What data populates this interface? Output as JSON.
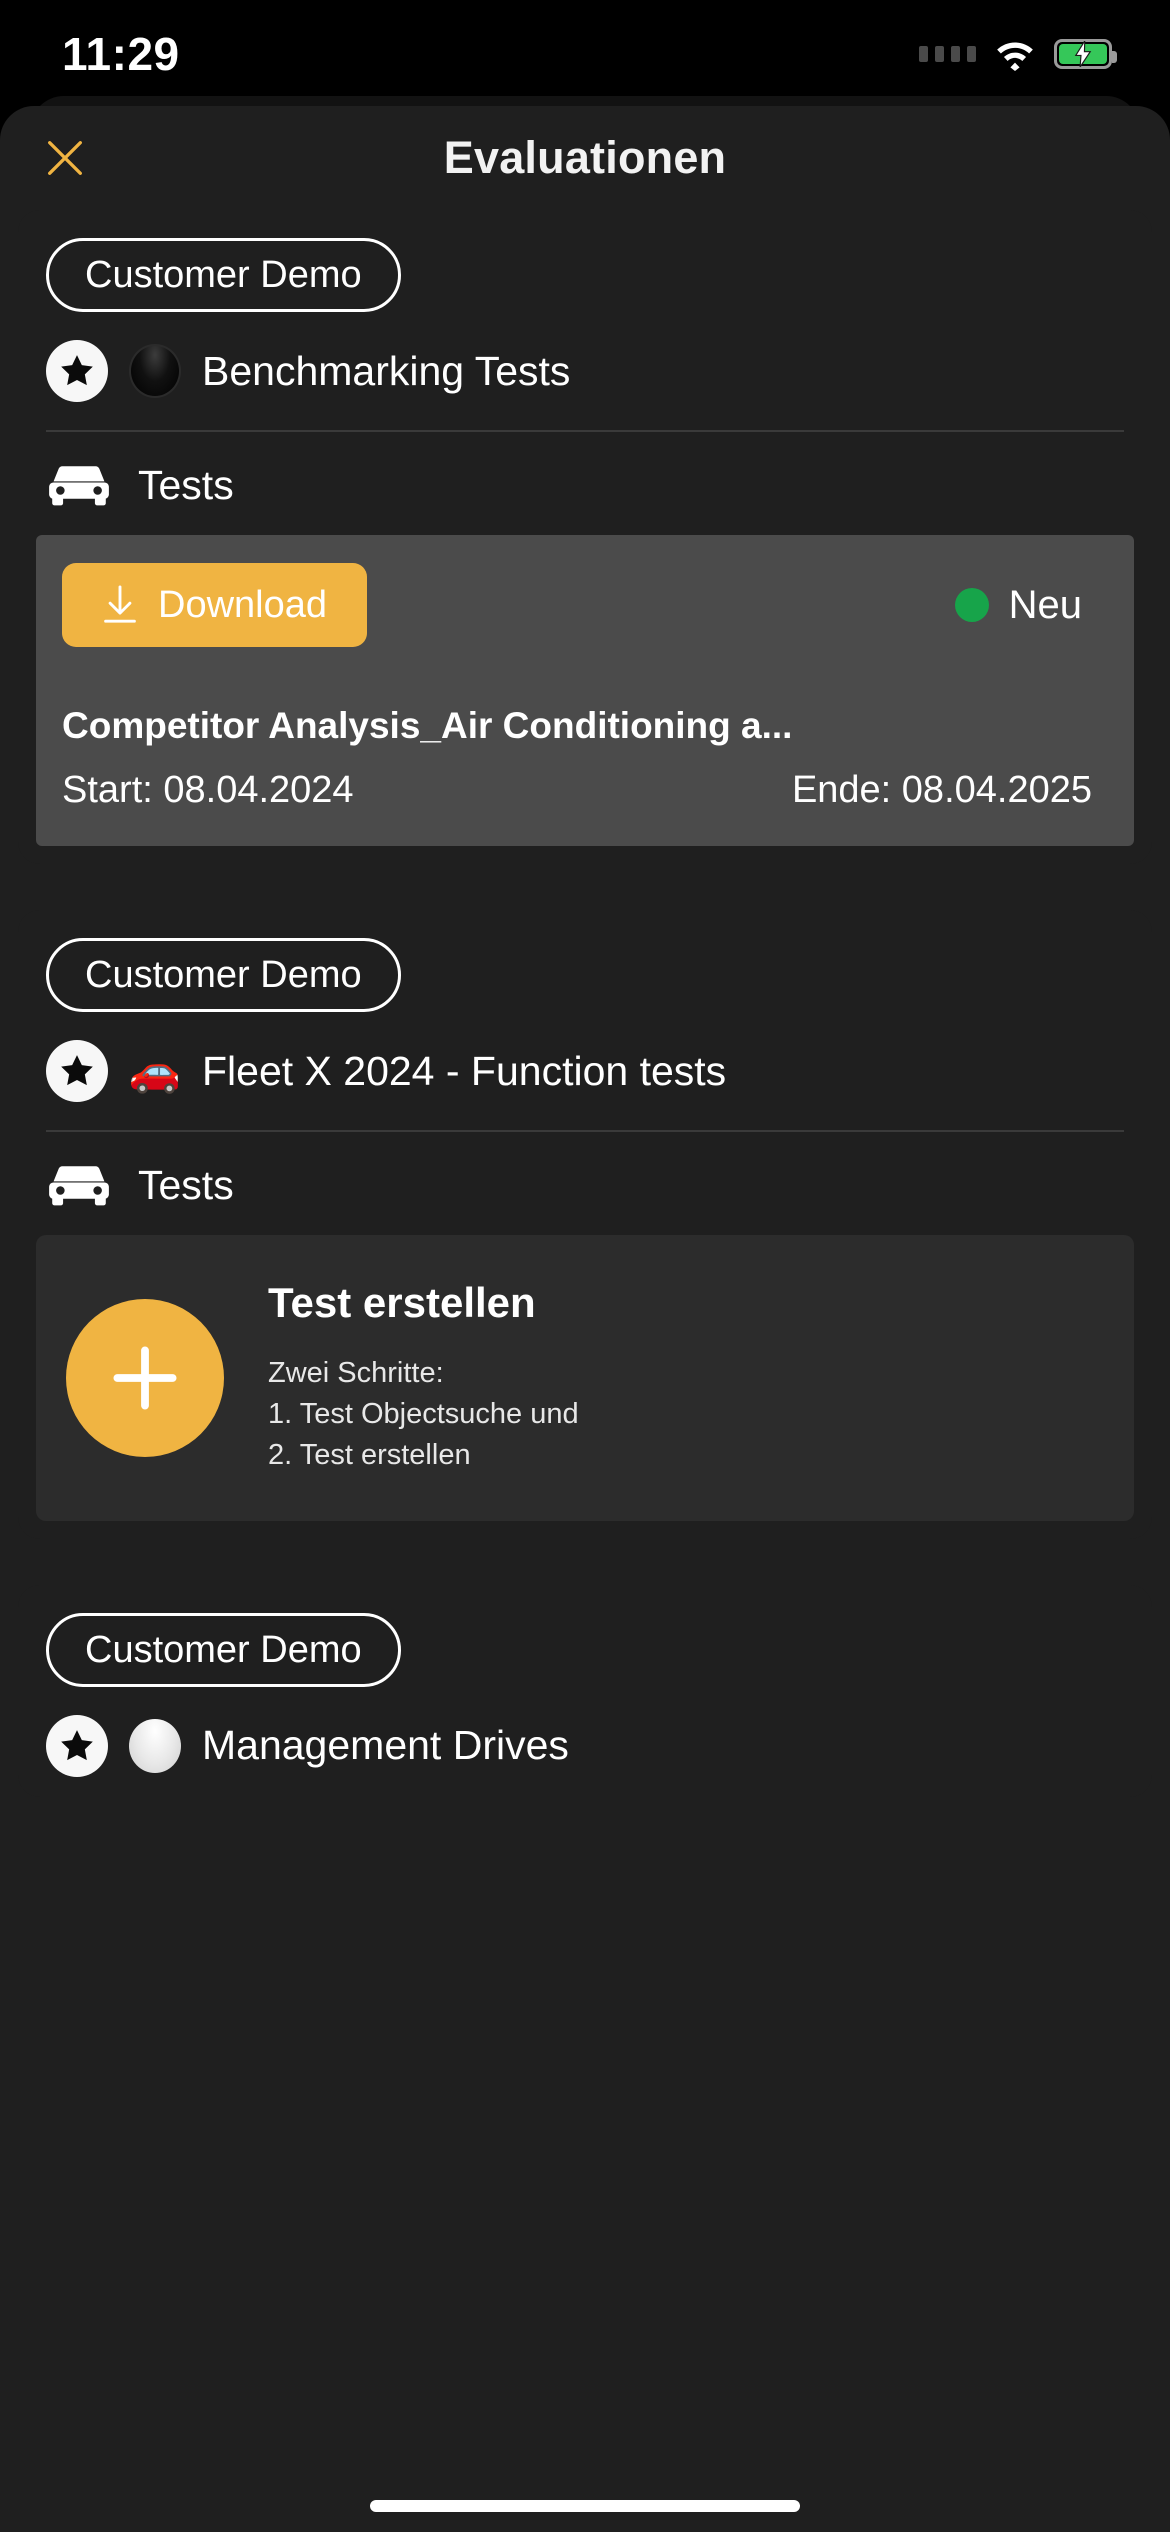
{
  "status_bar": {
    "time": "11:29",
    "wifi_icon": "wifi-icon",
    "battery_icon": "battery-charging-icon",
    "signal_icon": "signal-dots-icon"
  },
  "header": {
    "title": "Evaluationen",
    "close_icon": "close-x-icon",
    "accent_color": "#F0B442"
  },
  "colors": {
    "accent": "#F0B442",
    "panel": "#4B4B4B",
    "card": "#1F1F1F",
    "status_green": "#17A44A",
    "sheet": "#1F1F1F"
  },
  "cards": [
    {
      "customer_pill": "Customer Demo",
      "star_icon": "star-icon",
      "project_marker": "black-circle-emoji",
      "project_name": "Benchmarking Tests",
      "section_icon": "car-front-icon",
      "section_label": "Tests",
      "panel_type": "download",
      "download": {
        "button_label": "Download",
        "download_icon": "download-arrow-icon",
        "status_label": "Neu",
        "status_dot_color": "#17A44A",
        "title": "Competitor Analysis_Air Conditioning a...",
        "start_label": "Start: 08.04.2024",
        "end_label": "Ende: 08.04.2025"
      }
    },
    {
      "customer_pill": "Customer Demo",
      "star_icon": "star-icon",
      "project_marker": "red-car-emoji",
      "project_name": "Fleet X 2024 - Function tests",
      "section_icon": "car-front-icon",
      "section_label": "Tests",
      "panel_type": "create",
      "create": {
        "plus_icon": "plus-icon",
        "title": "Test erstellen",
        "subtitle": "Zwei Schritte:\n1. Test Objectsuche und\n2. Test erstellen"
      }
    },
    {
      "customer_pill": "Customer Demo",
      "star_icon": "star-icon",
      "project_marker": "white-circle-emoji",
      "project_name": "Management Drives"
    }
  ]
}
